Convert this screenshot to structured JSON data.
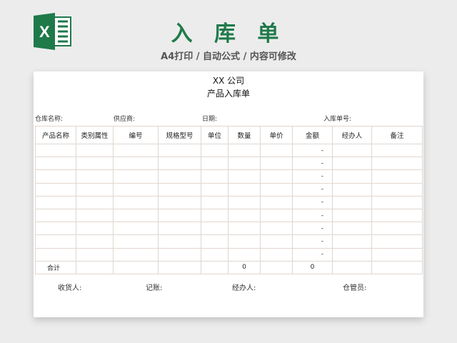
{
  "banner": {
    "title": "入 库 单",
    "subtitle": "A4打印 / 自动公式 / 内容可修改"
  },
  "sheet": {
    "company": "XX  公司",
    "doc_title": "产品入库单",
    "info": {
      "warehouse": "仓库名称:",
      "supplier": "供应商:",
      "date": "日期:",
      "receipt_no": "入库单号:"
    },
    "columns": [
      "产品名称",
      "类别属性",
      "编号",
      "规格型号",
      "单位",
      "数量",
      "单价",
      "金额",
      "经办人",
      "备注"
    ],
    "rows": [
      [
        "",
        "",
        "",
        "",
        "",
        "",
        "",
        "-",
        "",
        ""
      ],
      [
        "",
        "",
        "",
        "",
        "",
        "",
        "",
        "-",
        "",
        ""
      ],
      [
        "",
        "",
        "",
        "",
        "",
        "",
        "",
        "-",
        "",
        ""
      ],
      [
        "",
        "",
        "",
        "",
        "",
        "",
        "",
        "-",
        "",
        ""
      ],
      [
        "",
        "",
        "",
        "",
        "",
        "",
        "",
        "-",
        "",
        ""
      ],
      [
        "",
        "",
        "",
        "",
        "",
        "",
        "",
        "-",
        "",
        ""
      ],
      [
        "",
        "",
        "",
        "",
        "",
        "",
        "",
        "-",
        "",
        ""
      ],
      [
        "",
        "",
        "",
        "",
        "",
        "",
        "",
        "-",
        "",
        ""
      ],
      [
        "",
        "",
        "",
        "",
        "",
        "",
        "",
        "-",
        "",
        ""
      ]
    ],
    "total": {
      "label": "合计",
      "quantity": "0",
      "amount": "0"
    },
    "footer": {
      "receiver": "收货人:",
      "bookkeeper": "记账:",
      "handler": "经办人:",
      "keeper": "仓管员:"
    }
  },
  "colors": {
    "brand_green": "#1f7a4a",
    "table_border": "#b36a3f"
  },
  "icons": {
    "logo": "excel-logo-icon"
  }
}
